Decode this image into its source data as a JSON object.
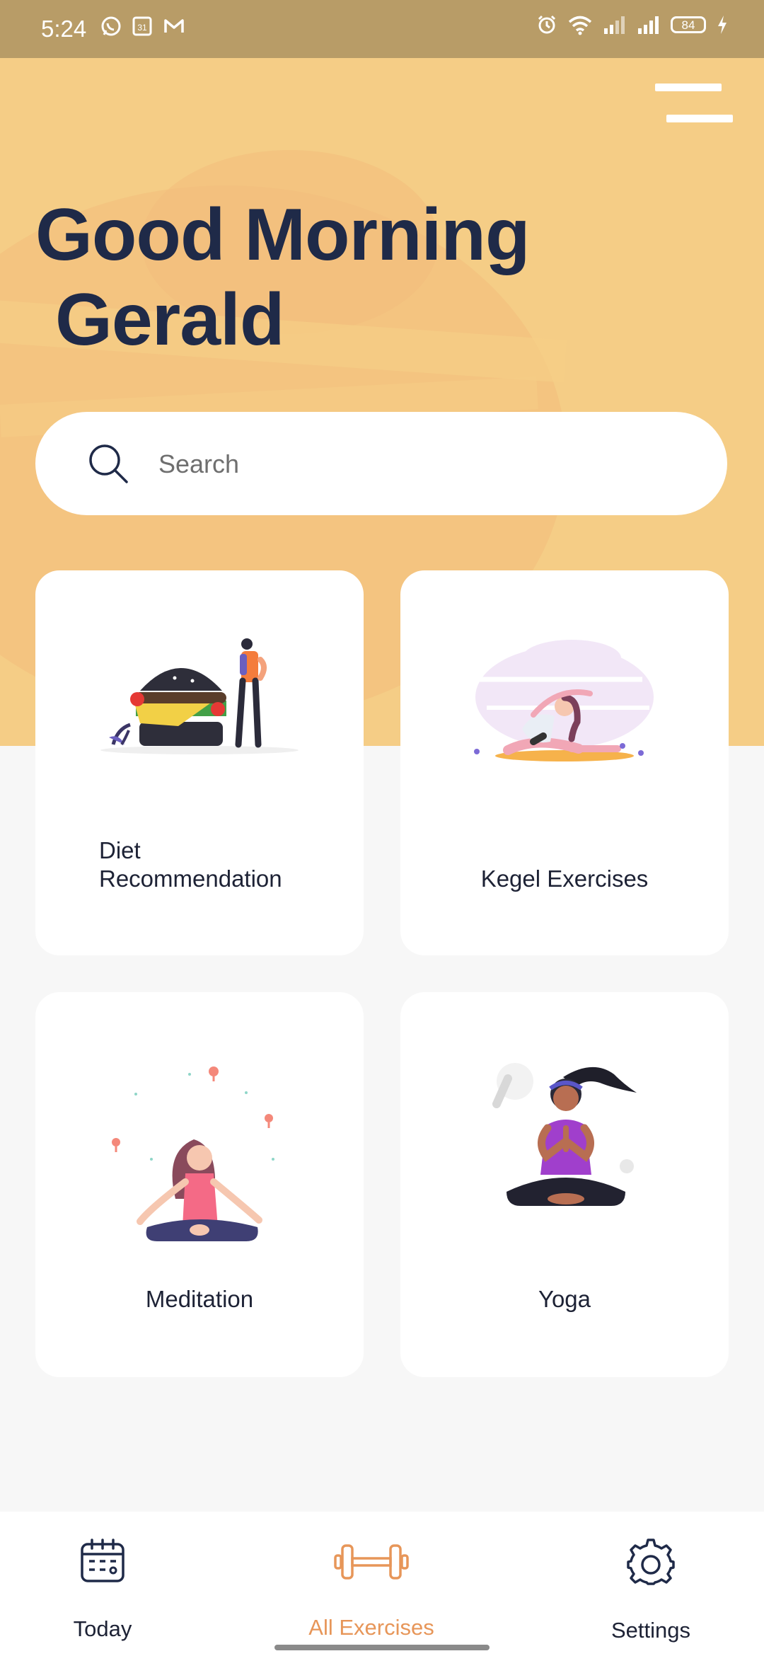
{
  "status_bar": {
    "time": "5:24",
    "battery": "84",
    "left_icons": [
      "whatsapp-icon",
      "calendar-31-icon",
      "gmail-icon"
    ],
    "right_icons": [
      "alarm-icon",
      "wifi-icon",
      "signal-icon",
      "signal-icon",
      "battery-icon",
      "charging-icon"
    ]
  },
  "header": {
    "greeting_line1": "Good Morning",
    "greeting_line2": "Gerald",
    "menu_icon": "menu-icon"
  },
  "search": {
    "placeholder": "Search",
    "value": ""
  },
  "cards": [
    {
      "label_line1": "Diet",
      "label_line2": "Recommendation",
      "illustration": "burger-person-illustration"
    },
    {
      "label": "Kegel Exercises",
      "illustration": "stretching-woman-illustration"
    },
    {
      "label": "Meditation",
      "illustration": "meditating-woman-illustration"
    },
    {
      "label": "Yoga",
      "illustration": "yoga-woman-illustration"
    }
  ],
  "bottom_nav": {
    "items": [
      {
        "label": "Today",
        "icon": "calendar-icon",
        "active": false
      },
      {
        "label": "All Exercises",
        "icon": "dumbbell-icon",
        "active": true
      },
      {
        "label": "Settings",
        "icon": "gear-icon",
        "active": false
      }
    ]
  },
  "colors": {
    "status_bar": "#b89c67",
    "hero": "#f5cd86",
    "heading": "#1f2a48",
    "accent": "#e79659",
    "background": "#f7f7f7"
  }
}
